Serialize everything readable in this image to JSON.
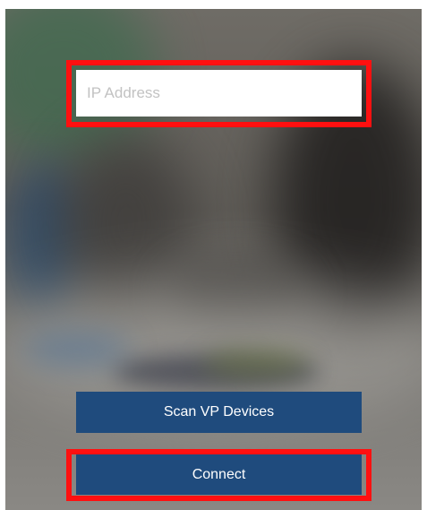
{
  "ip_input": {
    "placeholder": "IP Address",
    "value": ""
  },
  "buttons": {
    "scan_label": "Scan VP Devices",
    "connect_label": "Connect"
  },
  "colors": {
    "button_background": "#1f4b7d",
    "button_text": "#ffffff",
    "highlight_border": "#ff1010",
    "input_background": "#ffffff",
    "placeholder_text": "#c2c2c2"
  }
}
